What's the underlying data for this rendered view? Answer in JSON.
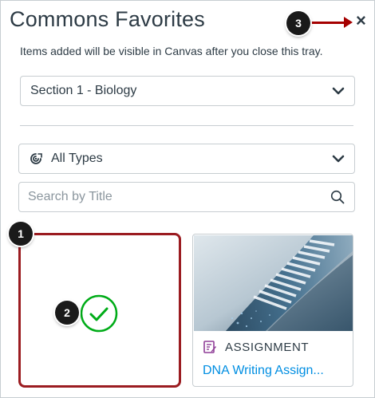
{
  "tray": {
    "title": "Commons Favorites",
    "close_label": "×",
    "info": "Items added will be visible in Canvas after you close this tray."
  },
  "filters": {
    "section": "Section 1 - Biology",
    "type": "All Types",
    "search_placeholder": "Search by Title"
  },
  "cards": [
    {
      "type_label": "ASSIGNMENT",
      "title": "DNA Writing Assign..."
    }
  ],
  "callouts": [
    "1",
    "2",
    "3"
  ],
  "icons": {
    "close": "close-icon",
    "chevron": "chevron-down-icon",
    "types": "commons-icon",
    "search": "search-icon",
    "check": "checkmark-circle-icon",
    "assignment": "assignment-icon"
  },
  "colors": {
    "selected_border": "#9b1c21",
    "arrow": "#a50000",
    "check": "#00ac18",
    "link": "#008ee2",
    "assignment": "#8f3e97"
  }
}
